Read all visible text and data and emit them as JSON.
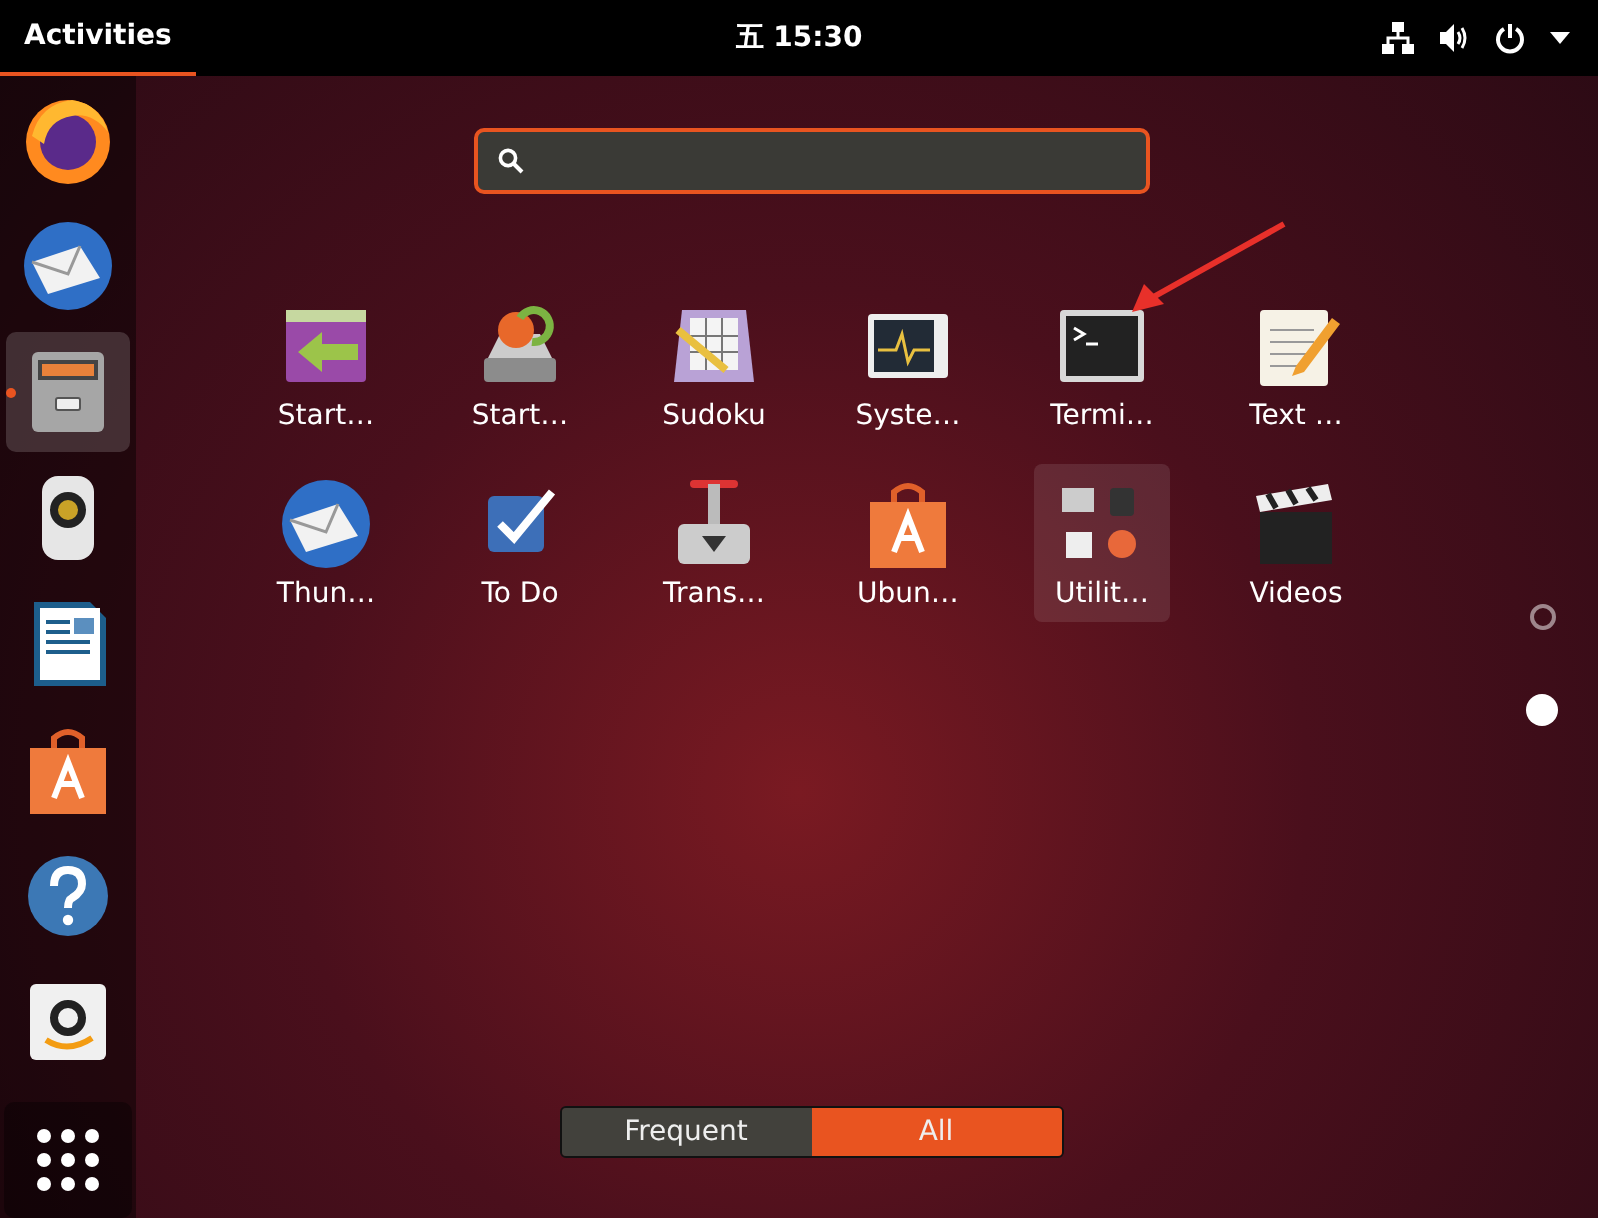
{
  "top_bar": {
    "activities": "Activities",
    "clock": "五 15:30"
  },
  "dock": [
    {
      "kind": "browser",
      "running": false,
      "selected": false
    },
    {
      "kind": "mail",
      "running": false,
      "selected": false
    },
    {
      "kind": "files",
      "running": true,
      "selected": true
    },
    {
      "kind": "speaker",
      "running": false,
      "selected": false
    },
    {
      "kind": "document",
      "running": false,
      "selected": false
    },
    {
      "kind": "store",
      "running": false,
      "selected": false
    },
    {
      "kind": "help",
      "running": false,
      "selected": false
    },
    {
      "kind": "shop",
      "running": false,
      "selected": false
    },
    {
      "kind": "grid",
      "running": false,
      "selected": false
    }
  ],
  "apps": [
    {
      "label": "Start…",
      "kind": "startup"
    },
    {
      "label": "Start…",
      "kind": "disk"
    },
    {
      "label": "Sudoku",
      "kind": "sudoku"
    },
    {
      "label": "Syste…",
      "kind": "monitor"
    },
    {
      "label": "Termi…",
      "kind": "terminal"
    },
    {
      "label": "Text …",
      "kind": "notepad"
    },
    {
      "label": "Thun…",
      "kind": "mail"
    },
    {
      "label": "To Do",
      "kind": "todo"
    },
    {
      "label": "Trans…",
      "kind": "transfer"
    },
    {
      "label": "Ubun…",
      "kind": "store"
    },
    {
      "label": "Utilit…",
      "kind": "folder"
    },
    {
      "label": "Videos",
      "kind": "clapper"
    }
  ],
  "pages": [
    {
      "selected": false
    },
    {
      "selected": true
    }
  ],
  "view_tabs": [
    {
      "label": "Frequent",
      "selected": false
    },
    {
      "label": "All",
      "selected": true
    }
  ]
}
